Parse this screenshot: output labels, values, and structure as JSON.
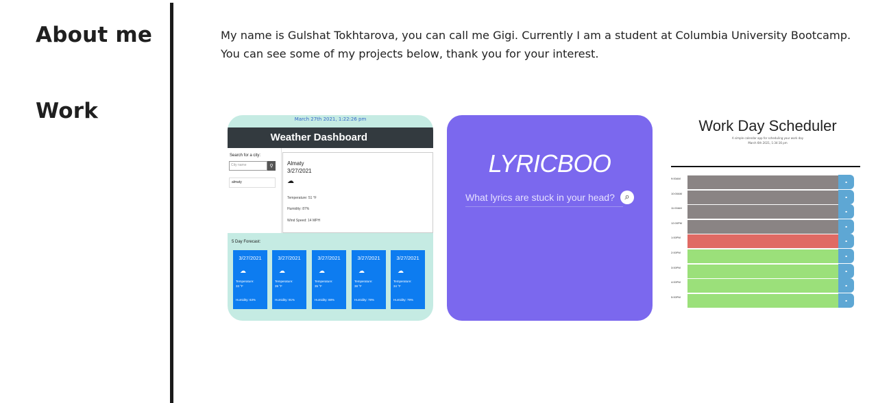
{
  "nav": {
    "about": "About me",
    "work": "Work"
  },
  "intro": {
    "line1": "My name is Gulshat Tokhtarova, you can call me Gigi. Currently I am a student at Columbia University Bootcamp.",
    "line2": "You can see some of my projects below, thank you for your interest."
  },
  "weather": {
    "date": "March 27th 2021, 1:22:26 pm",
    "title": "Weather Dashboard",
    "search_label": "Search for a city:",
    "search_placeholder": "City name",
    "history": "almaty",
    "city": "Almaty",
    "city_date": "3/27/2021",
    "temperature": "Temperature: 51 °F",
    "humidity": "Humidity: 87%",
    "wind": "Wind Speed: 14 MPH",
    "forecast_title": "5 Day Forecast:",
    "forecast": [
      {
        "date": "3/27/2021",
        "temp_label": "Temperature:",
        "temp": "33 °F",
        "humidity": "Humidity: 63%"
      },
      {
        "date": "3/27/2021",
        "temp_label": "Temperature:",
        "temp": "39 °F",
        "humidity": "Humidity: 91%"
      },
      {
        "date": "3/27/2021",
        "temp_label": "Temperature:",
        "temp": "35 °F",
        "humidity": "Humidity: 88%"
      },
      {
        "date": "3/27/2021",
        "temp_label": "Temperature:",
        "temp": "38 °F",
        "humidity": "Humidity: 78%"
      },
      {
        "date": "3/27/2021",
        "temp_label": "Temperature:",
        "temp": "34 °F",
        "humidity": "Humidity: 79%"
      }
    ]
  },
  "lyric": {
    "logo": "LYRICBOO",
    "placeholder": "What lyrics are stuck in your head?",
    "search_icon": "magnifier-icon"
  },
  "scheduler": {
    "title": "Work Day Scheduler",
    "subtitle": "A simple calendar app for scheduling your work day",
    "date": "March 6th 2021, 1:34:16 pm",
    "colors": {
      "past": "#8a8484",
      "present": "#e06a64",
      "future": "#9be07a",
      "save": "#5ea7d4"
    },
    "rows": [
      {
        "time": "9:00AM",
        "state": "past"
      },
      {
        "time": "10:00AM",
        "state": "past"
      },
      {
        "time": "11:00AM",
        "state": "past"
      },
      {
        "time": "12:00PM",
        "state": "past"
      },
      {
        "time": "1:00PM",
        "state": "present"
      },
      {
        "time": "2:00PM",
        "state": "future"
      },
      {
        "time": "3:00PM",
        "state": "future"
      },
      {
        "time": "4:00PM",
        "state": "future"
      },
      {
        "time": "5:00PM",
        "state": "future"
      }
    ]
  }
}
